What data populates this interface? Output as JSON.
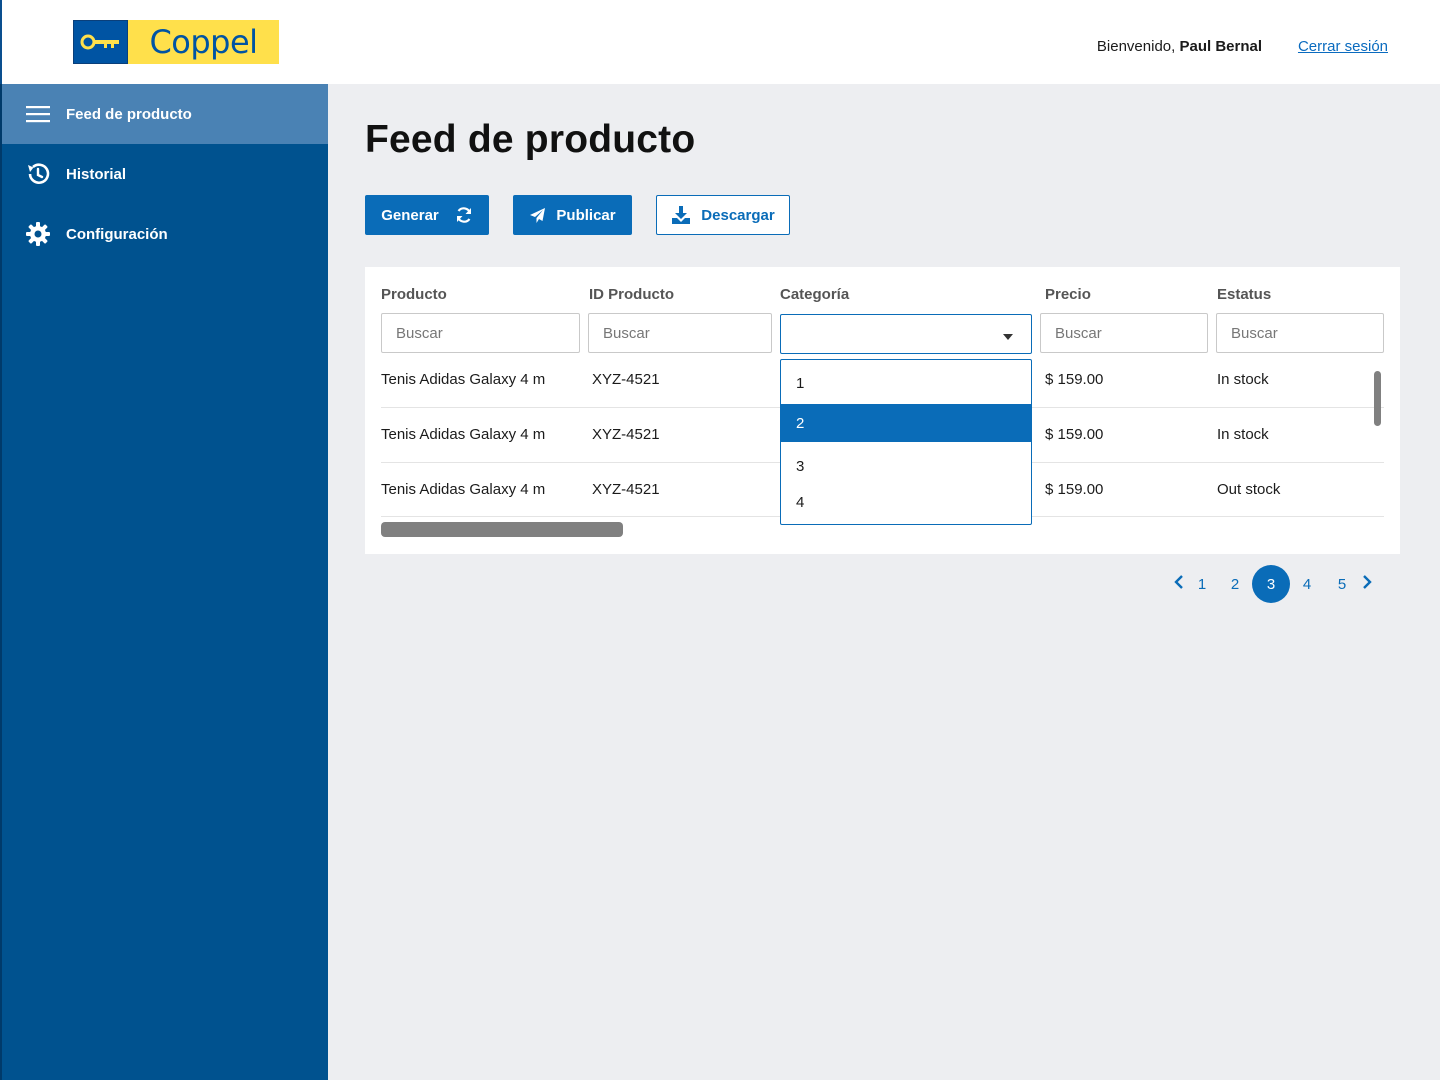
{
  "header": {
    "logo_text": "Coppel",
    "welcome_prefix": "Bienvenido, ",
    "user_name": "Paul Bernal",
    "logout_label": "Cerrar sesión"
  },
  "sidebar": {
    "items": [
      {
        "label": "Feed de producto",
        "icon": "menu-icon",
        "active": true
      },
      {
        "label": "Historial",
        "icon": "history-icon",
        "active": false
      },
      {
        "label": "Configuración",
        "icon": "gear-icon",
        "active": false
      }
    ]
  },
  "main": {
    "title": "Feed de producto",
    "buttons": {
      "generate": "Generar",
      "publish": "Publicar",
      "download": "Descargar"
    }
  },
  "table": {
    "columns": [
      "Producto",
      "ID Producto",
      "Categoría",
      "Precio",
      "Estatus"
    ],
    "filter_placeholder": "Buscar",
    "category_value": "",
    "rows": [
      {
        "product": "Tenis Adidas Galaxy 4 m",
        "id": "XYZ-4521",
        "price": "$ 159.00",
        "status": "In stock"
      },
      {
        "product": "Tenis Adidas Galaxy 4 m",
        "id": "XYZ-4521",
        "price": "$ 159.00",
        "status": "In stock"
      },
      {
        "product": "Tenis Adidas Galaxy 4 m",
        "id": "XYZ-4521",
        "price": "$ 159.00",
        "status": "Out stock"
      }
    ],
    "category_options": [
      "1",
      "2",
      "3",
      "4"
    ],
    "category_highlighted": "2"
  },
  "pagination": {
    "pages": [
      "1",
      "2",
      "3",
      "4",
      "5"
    ],
    "current": "3"
  },
  "colors": {
    "brand_blue": "#0a6cb8",
    "sidebar_blue": "#00528f",
    "sidebar_active": "#4a82b4",
    "logo_yellow": "#ffe04b"
  }
}
